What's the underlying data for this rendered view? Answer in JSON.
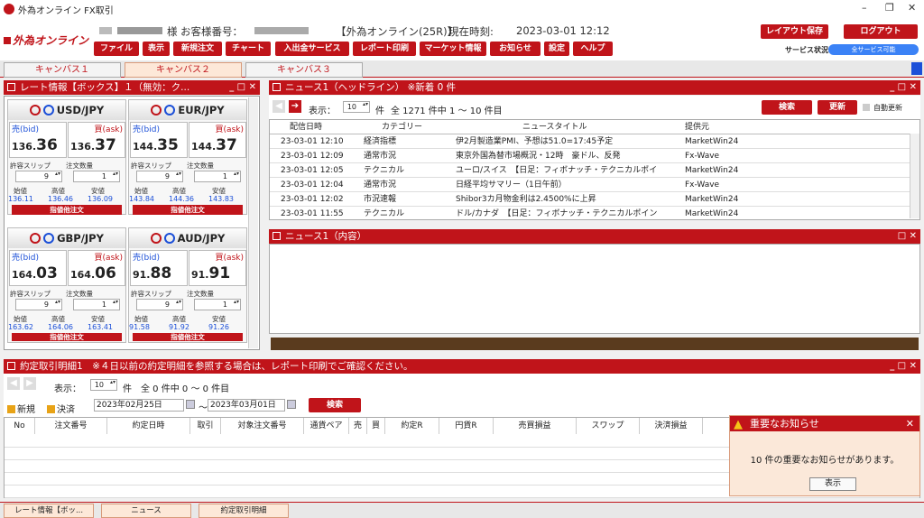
{
  "window": {
    "title": "外為オンライン FX取引",
    "controls": [
      "–",
      "❐",
      "✕"
    ]
  },
  "header": {
    "brand": "外為オンライン",
    "customer_suffix": "様",
    "customer_label": "お客様番号：",
    "service": "【外為オンライン(25R)】",
    "time_label": "現在時刻:",
    "time_value": "2023-03-01 12:12",
    "layout_save": "レイアウト保存",
    "logout": "ログアウト",
    "service_status_label": "サービス状況",
    "service_status_value": "全サービス可能",
    "menu": [
      "ファイル",
      "表示",
      "新規注文",
      "チャート",
      "入出金サービス",
      "レポート印刷",
      "マーケット情報",
      "お知らせ",
      "設定",
      "ヘルプ"
    ]
  },
  "canvas_tabs": [
    "キャンバス１",
    "キャンバス２",
    "キャンバス３"
  ],
  "rate_panel": {
    "title": "レート情報【ボックス】１（無効：ク...",
    "controls": "_ □ ✕",
    "bid_label": "売(bid)",
    "ask_label": "買(ask)",
    "slip_label": "許容スリップ",
    "qty_label": "注文数量",
    "open_label": "始値",
    "high_label": "高値",
    "low_label": "安値",
    "order_button": "指値他注文",
    "cards": [
      {
        "pair": "USD/JPY",
        "bid_pre": "136.",
        "bid_big": "36",
        "ask_pre": "136.",
        "ask_big": "37",
        "slip": "9",
        "qty": "1",
        "open": "136.11",
        "high": "136.46",
        "low": "136.09"
      },
      {
        "pair": "EUR/JPY",
        "bid_pre": "144.",
        "bid_big": "35",
        "ask_pre": "144.",
        "ask_big": "37",
        "slip": "9",
        "qty": "1",
        "open": "143.84",
        "high": "144.36",
        "low": "143.83"
      },
      {
        "pair": "GBP/JPY",
        "bid_pre": "164.",
        "bid_big": "03",
        "ask_pre": "164.",
        "ask_big": "06",
        "slip": "9",
        "qty": "1",
        "open": "163.62",
        "high": "164.06",
        "low": "163.41"
      },
      {
        "pair": "AUD/JPY",
        "bid_pre": "91.",
        "bid_big": "88",
        "ask_pre": "91.",
        "ask_big": "91",
        "slip": "9",
        "qty": "1",
        "open": "91.58",
        "high": "91.92",
        "low": "91.26"
      }
    ]
  },
  "news_headline": {
    "title": "ニュース1（ヘッドライン） ※新着 0 件",
    "controls": "_ □ ✕",
    "display_label": "表示：",
    "count": "10",
    "count_suffix": "件",
    "total": "全 1271 件中 1 ～ 10 件目",
    "search": "検索",
    "refresh": "更新",
    "auto_refresh": "自動更新",
    "columns": [
      "配信日時",
      "カテゴリー",
      "ニュースタイトル",
      "提供元"
    ],
    "rows": [
      [
        "23-03-01 12:10",
        "経済指標",
        "伊2月製造業PMI、予想は51.0=17:45予定",
        "MarketWin24"
      ],
      [
        "23-03-01 12:09",
        "通常市況",
        "東京外国為替市場概況・12時　豪ドル、反発",
        "Fx-Wave"
      ],
      [
        "23-03-01 12:05",
        "テクニカル",
        "ユーロ/スイス　【日足：フィボナッチ・テクニカルポイ",
        "MarketWin24"
      ],
      [
        "23-03-01 12:04",
        "通常市況",
        "日経平均サマリー（1日午前）",
        "Fx-Wave"
      ],
      [
        "23-03-01 12:02",
        "市況速報",
        "Shibor3カ月物金利は2.4500%に上昇",
        "MarketWin24"
      ],
      [
        "23-03-01 11:55",
        "テクニカル",
        "ドル/カナダ　【日足：フィボナッチ・テクニカルポイン",
        "MarketWin24"
      ]
    ]
  },
  "news_content": {
    "title": "ニュース1（内容）",
    "controls": "□ ✕"
  },
  "trade_panel": {
    "title": "約定取引明細1　※４日以前の約定明細を参照する場合は、レポート印刷でご確認ください。",
    "controls": "_ □ ✕",
    "display_label": "表示：",
    "count": "10",
    "count_suffix": "件",
    "total": "全 0 件中 0 ～ 0 件目",
    "new_label": "新規",
    "settle_label": "決済",
    "date_from": "2023年02月25日",
    "tilde": "～",
    "date_to": "2023年03月01日",
    "search": "検索",
    "columns": [
      "No",
      "注文番号",
      "約定日時",
      "取引",
      "対象注文番号",
      "通貨ペア",
      "売",
      "買",
      "約定R",
      "円貨R",
      "売買損益",
      "スワップ",
      "決済損益"
    ]
  },
  "notice": {
    "title": "重要なお知らせ",
    "message": "10 件の重要なお知らせがあります。",
    "button": "表示"
  },
  "bottom_tabs": [
    "レート情報【ボッ...",
    "ニュース",
    "約定取引明細"
  ],
  "colors": {
    "accent": "#c0141a",
    "bid": "#1b4fd8"
  }
}
